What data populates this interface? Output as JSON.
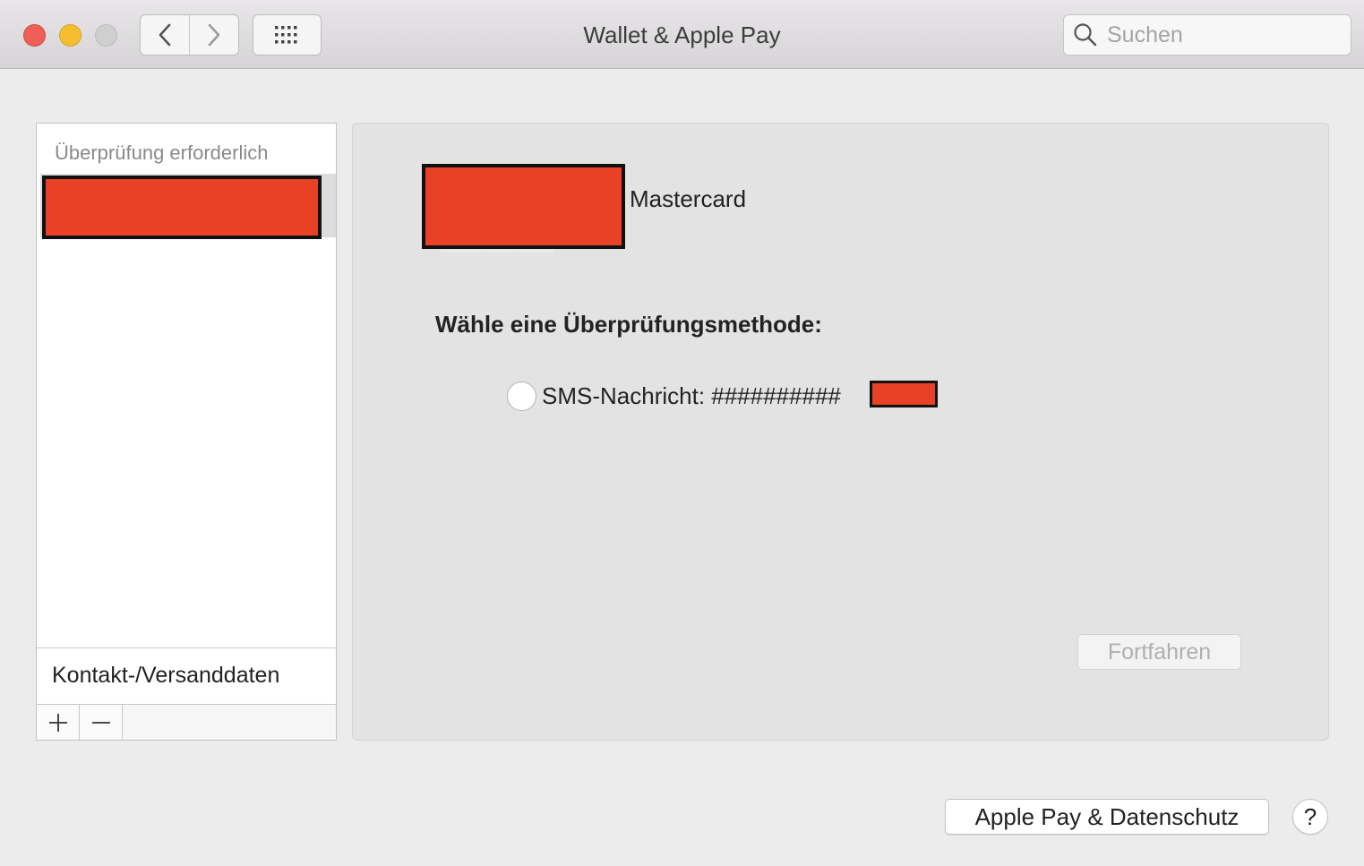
{
  "window": {
    "title": "Wallet & Apple Pay"
  },
  "search": {
    "placeholder": "Suchen",
    "value": ""
  },
  "sidebar": {
    "section_header": "Überprüfung erforderlich",
    "contact_item": "Kontakt-/Versanddaten"
  },
  "card": {
    "name": "Mastercard"
  },
  "verification": {
    "title": "Wähle eine Überprüfungsmethode:",
    "sms_option": "SMS-Nachricht: ##########"
  },
  "buttons": {
    "continue": "Fortfahren",
    "privacy": "Apple Pay & Datenschutz",
    "help": "?"
  },
  "colors": {
    "redaction": "#e84125",
    "close": "#ed5f57",
    "minimize": "#f5bd2f",
    "zoom_disabled": "#d0cfd0"
  },
  "icons": [
    "back-chevron-icon",
    "forward-chevron-icon",
    "grid-icon",
    "search-icon",
    "plus-icon",
    "minus-icon"
  ]
}
